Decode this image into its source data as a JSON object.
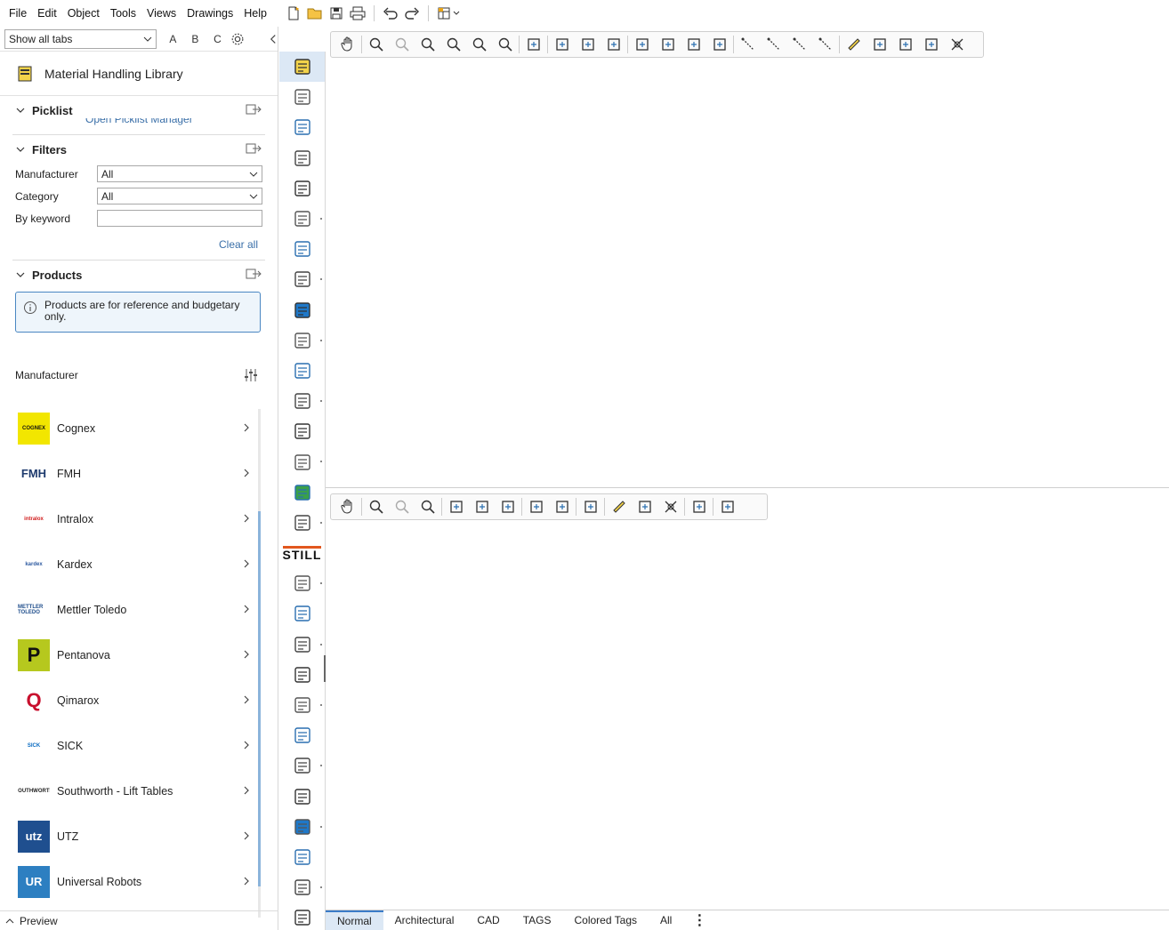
{
  "menu": {
    "items": [
      "File",
      "Edit",
      "Object",
      "Tools",
      "Views",
      "Drawings",
      "Help"
    ]
  },
  "toolbar": {
    "icons": [
      "new-file-icon",
      "open-folder-icon",
      "save-icon",
      "print-icon",
      "undo-icon",
      "redo-icon",
      "layout-icon"
    ]
  },
  "panel": {
    "tabs_select": "Show all tabs",
    "letters": [
      "A",
      "B",
      "C"
    ],
    "library_title": "Material Handling Library",
    "picklist": {
      "label": "Picklist",
      "link": "Open Picklist Manager"
    },
    "filters": {
      "label": "Filters",
      "manufacturer_label": "Manufacturer",
      "manufacturer_value": "All",
      "category_label": "Category",
      "category_value": "All",
      "keyword_label": "By keyword",
      "keyword_value": "",
      "clear_all": "Clear all"
    },
    "products": {
      "label": "Products",
      "info": "Products are for reference and budgetary only."
    },
    "manufacturer_heading": "Manufacturer",
    "manufacturers": [
      {
        "name": "Cognex",
        "logo_text": "COGNEX",
        "logo_bg": "#f2e600",
        "logo_fg": "#111"
      },
      {
        "name": "FMH",
        "logo_text": "FMH",
        "logo_bg": "#ffffff",
        "logo_fg": "#1e3b6e"
      },
      {
        "name": "Intralox",
        "logo_text": "intralox",
        "logo_bg": "#ffffff",
        "logo_fg": "#d01a1a"
      },
      {
        "name": "Kardex",
        "logo_text": "kardex",
        "logo_bg": "#ffffff",
        "logo_fg": "#2d5aa0"
      },
      {
        "name": "Mettler Toledo",
        "logo_text": "METTLER TOLEDO",
        "logo_bg": "#ffffff",
        "logo_fg": "#1f4e8c"
      },
      {
        "name": "Pentanova",
        "logo_text": "P",
        "logo_bg": "#b6c81e",
        "logo_fg": "#111"
      },
      {
        "name": "Qimarox",
        "logo_text": "Q",
        "logo_bg": "#ffffff",
        "logo_fg": "#c8102e"
      },
      {
        "name": "SICK",
        "logo_text": "SICK",
        "logo_bg": "#ffffff",
        "logo_fg": "#0a6bc1"
      },
      {
        "name": "Southworth - Lift Tables",
        "logo_text": "SOUTHWORTH",
        "logo_bg": "#ffffff",
        "logo_fg": "#222"
      },
      {
        "name": "UTZ",
        "logo_text": "utz",
        "logo_bg": "#1f4f8f",
        "logo_fg": "#ffffff"
      },
      {
        "name": "Universal Robots",
        "logo_text": "UR",
        "logo_bg": "#2d7fc1",
        "logo_fg": "#ffffff"
      }
    ],
    "preview_label": "Preview"
  },
  "icon_strip": [
    "material-handling-icon",
    "tools-icon",
    "building-icon",
    "cup-icon",
    "vehicle-icon",
    "computer-icon",
    "people-icon",
    "plant-icon",
    "cube-3d-icon",
    "floor-plan-icon",
    "plumbing-icon",
    "kitchen-icon",
    "lightbulb-icon",
    "home-icon",
    "medical-icon",
    "pattern-icon",
    "still-logo",
    "brand-logo-icon",
    "robot-arm-icon",
    "lamp-icon",
    "fan-icon",
    "stairs-icon",
    "stairs-edit-icon",
    "light-fixture-icon",
    "shelving-icon",
    "fireplace-icon",
    "flag-icon",
    "cube-wire-icon",
    "network-icon"
  ],
  "still_text": "STILL",
  "bottom_tabs": [
    "Normal",
    "Architectural",
    "CAD",
    "TAGS",
    "Colored Tags",
    "All"
  ],
  "active_tab": "Normal",
  "colors": {
    "accent": "#3a7bc8",
    "active_bg": "#dce8f5",
    "link": "#3a6fa8"
  }
}
